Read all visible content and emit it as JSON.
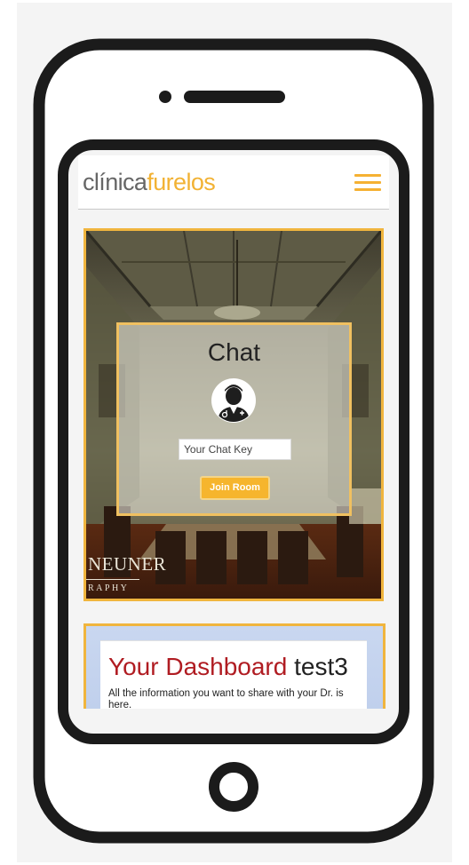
{
  "header": {
    "logo_part1": "clínica",
    "logo_part2": "furelos"
  },
  "chat": {
    "title": "Chat",
    "key_placeholder": "Your Chat Key",
    "join_label": "Join Room"
  },
  "hero": {
    "watermark_line1": "NEUNER",
    "watermark_line2": "RAPHY"
  },
  "dashboard": {
    "title_red": "Your Dashboard",
    "title_user": "test3",
    "description": "All the information you want to share with your Dr. is here."
  },
  "colors": {
    "accent": "#f5b133",
    "dashboard_title": "#b01c22",
    "logo_grey": "#666666"
  },
  "icons": {
    "menu": "hamburger-menu-icon",
    "avatar": "doctor-avatar-icon"
  }
}
